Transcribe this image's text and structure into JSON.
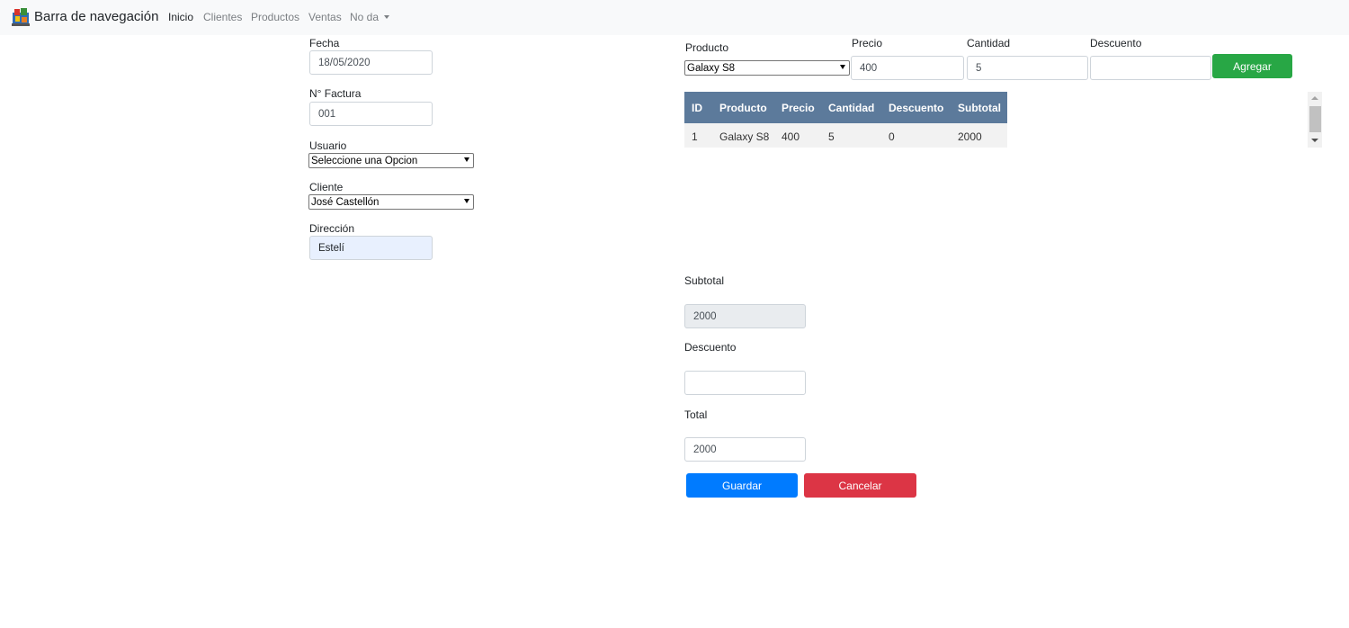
{
  "navbar": {
    "brand": "Barra de navegación",
    "links": [
      "Inicio",
      "Clientes",
      "Productos",
      "Ventas"
    ],
    "dropdown_label": "No da"
  },
  "left_form": {
    "fecha_label": "Fecha",
    "fecha_value": "18/05/2020",
    "factura_label": "N° Factura",
    "factura_value": "001",
    "usuario_label": "Usuario",
    "usuario_value": "Seleccione una Opcion",
    "cliente_label": "Cliente",
    "cliente_value": "José Castellón",
    "direccion_label": "Dirección",
    "direccion_value": "Estelí"
  },
  "product_form": {
    "producto_label": "Producto",
    "producto_value": "Galaxy S8",
    "precio_label": "Precio",
    "precio_value": "400",
    "cantidad_label": "Cantidad",
    "cantidad_value": "5",
    "descuento_label": "Descuento",
    "descuento_value": "",
    "agregar_label": "Agregar"
  },
  "table": {
    "headers": [
      "ID",
      "Producto",
      "Precio",
      "Cantidad",
      "Descuento",
      "Subtotal"
    ],
    "rows": [
      [
        "1",
        "Galaxy S8",
        "400",
        "5",
        "0",
        "2000"
      ]
    ]
  },
  "totals": {
    "subtotal_label": "Subtotal",
    "subtotal_value": "2000",
    "descuento_label": "Descuento",
    "descuento_value": "",
    "total_label": "Total",
    "total_value": "2000"
  },
  "actions": {
    "guardar_label": "Guardar",
    "cancelar_label": "Cancelar"
  },
  "colors": {
    "navbar_bg": "#f8f9fa",
    "table_header": "#5c7a9b",
    "success": "#28a745",
    "primary": "#007bff",
    "danger": "#dc3545"
  }
}
